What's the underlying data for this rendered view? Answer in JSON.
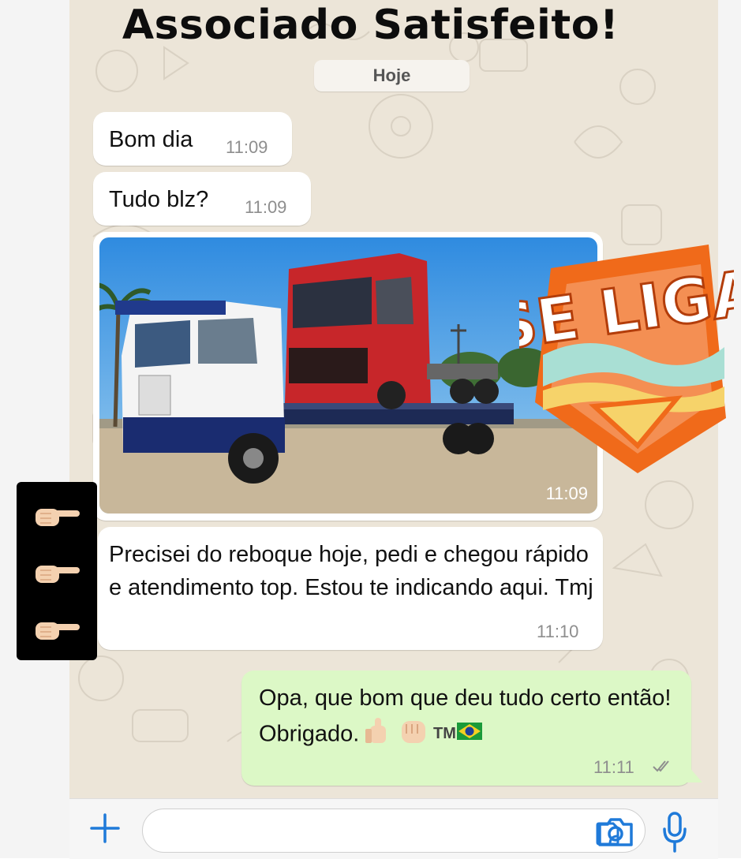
{
  "headline": "Associado Satisfeito!",
  "date_chip": "Hoje",
  "messages": [
    {
      "text": "Bom dia",
      "time": "11:09"
    },
    {
      "text": "Tudo blz?",
      "time": "11:09"
    },
    {
      "image": "truck-photo",
      "time": "11:09"
    },
    {
      "text": "Precisei do reboque hoje, pedi e chegou rápido e atendimento top. Estou te indicando aqui. Tmj",
      "time": "11:10"
    },
    {
      "text": "Opa, que bom que deu tudo certo então! Obrigado.",
      "time": "11:11",
      "emojis": "thumbs-up, fist, TM, brazil-flag",
      "trade": "TM",
      "status": "read"
    }
  ],
  "sticker_text": "SE LIGA",
  "input_bar": {
    "placeholder": ""
  },
  "colors": {
    "chat_bg": "#ece5d8",
    "outgoing": "#dcf8c6",
    "incoming": "#ffffff",
    "accent": "#1f7ad9"
  }
}
